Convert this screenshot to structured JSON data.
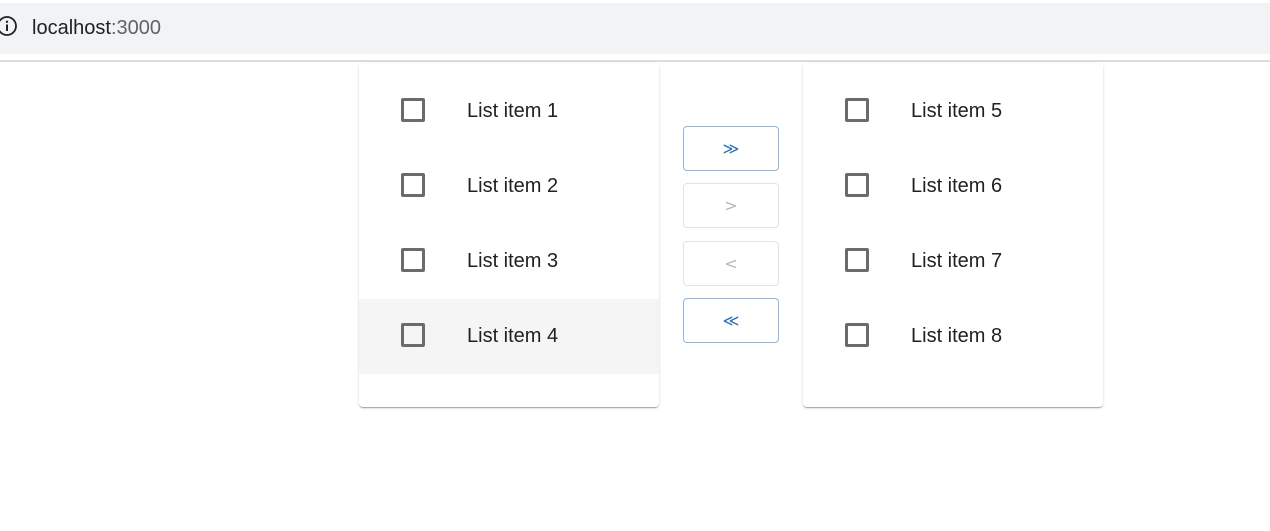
{
  "browser": {
    "host": "localhost",
    "port": ":3000"
  },
  "left_list": {
    "items": [
      {
        "label": "List item 1"
      },
      {
        "label": "List item 2"
      },
      {
        "label": "List item 3"
      },
      {
        "label": "List item 4"
      }
    ]
  },
  "right_list": {
    "items": [
      {
        "label": "List item 5"
      },
      {
        "label": "List item 6"
      },
      {
        "label": "List item 7"
      },
      {
        "label": "List item 8"
      }
    ]
  },
  "transfer": {
    "move_all_right": "≫",
    "move_selected_right": ">",
    "move_selected_left": "<",
    "move_all_left": "≪"
  },
  "colors": {
    "accent": "#2e73b8",
    "disabled": "#b5b5b5"
  }
}
